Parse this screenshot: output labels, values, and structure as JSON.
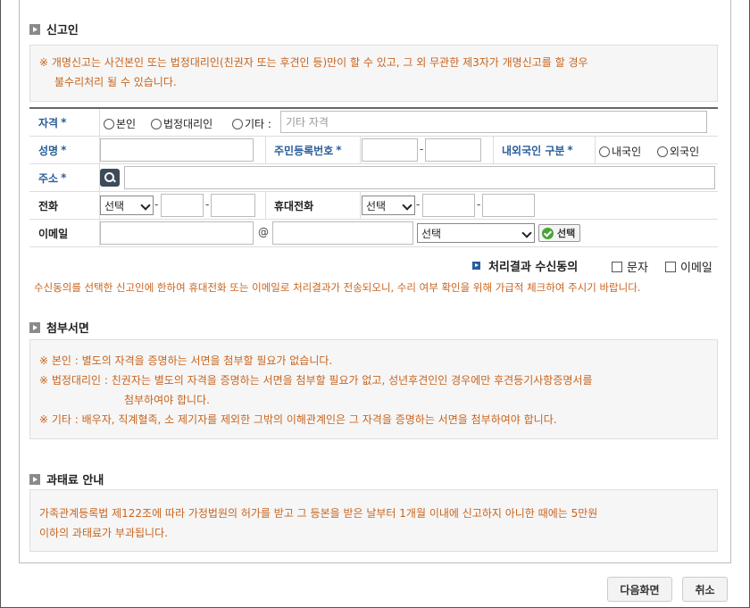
{
  "reporter_section": {
    "title": "신고인",
    "notice_line1": "※ 개명신고는 사건본인 또는 법정대리인(친권자 또는 후견인 등)만이 할 수 있고, 그 외 무관한 제3자가 개명신고를 할 경우",
    "notice_line2": "불수리처리 될 수 있습니다."
  },
  "form": {
    "qualification": {
      "label": "자격",
      "required": "*",
      "options": [
        "본인",
        "법정대리인",
        "기타 :"
      ],
      "other_placeholder": "기타 자격"
    },
    "name": {
      "label": "성명",
      "required": "*"
    },
    "resident_number": {
      "label": "주민등록번호",
      "required": "*",
      "separator": "-"
    },
    "nationality": {
      "label": "내외국인 구분",
      "required": "*",
      "options": [
        "내국인",
        "외국인"
      ]
    },
    "address": {
      "label": "주소",
      "required": "*"
    },
    "phone": {
      "label": "전화",
      "select_value": "선택",
      "separator": "-"
    },
    "mobile": {
      "label": "휴대전화",
      "select_value": "선택",
      "separator": "-"
    },
    "email": {
      "label": "이메일",
      "at": "@",
      "domain_select_value": "선택",
      "select_button": "선택"
    }
  },
  "consent": {
    "label": "처리결과 수신동의",
    "options": [
      "문자",
      "이메일"
    ],
    "notice": "수신동의를 선택한 신고인에 한하여 휴대전화 또는 이메일로 처리결과가 전송되오니, 수리 여부 확인을 위해 가급적 체크하여 주시기 바랍니다."
  },
  "attachment_section": {
    "title": "첨부서면",
    "line1": "※ 본인 : 별도의 자격을 증명하는 서면을 첨부할 필요가 없습니다.",
    "line2": "※ 법정대리인 : 친권자는 별도의 자격을 증명하는 서면을 첨부할 필요가 없고, 성년후견인인 경우에만 후견등기사항증명서를",
    "line3": "첨부하여야 합니다.",
    "line4": "※ 기타 : 배우자, 직계혈족, 소 제기자를 제외한 그밖의 이해관계인은 그 자격을 증명하는 서면을 첨부하여야 합니다."
  },
  "fine_section": {
    "title": "과태료 안내",
    "line1": "가족관계등록법 제122조에 따라 가정법원의 허가를 받고 그 등본을 받은 날부터 1개월 이내에 신고하지 아니한 때에는 5만원",
    "line2": "이하의 과태료가 부과됩니다."
  },
  "buttons": {
    "next": "다음화면",
    "cancel": "취소"
  },
  "colors": {
    "accent_blue": "#2a5d9b",
    "notice_orange": "#c8641e",
    "ok_green": "#4aa33a"
  }
}
